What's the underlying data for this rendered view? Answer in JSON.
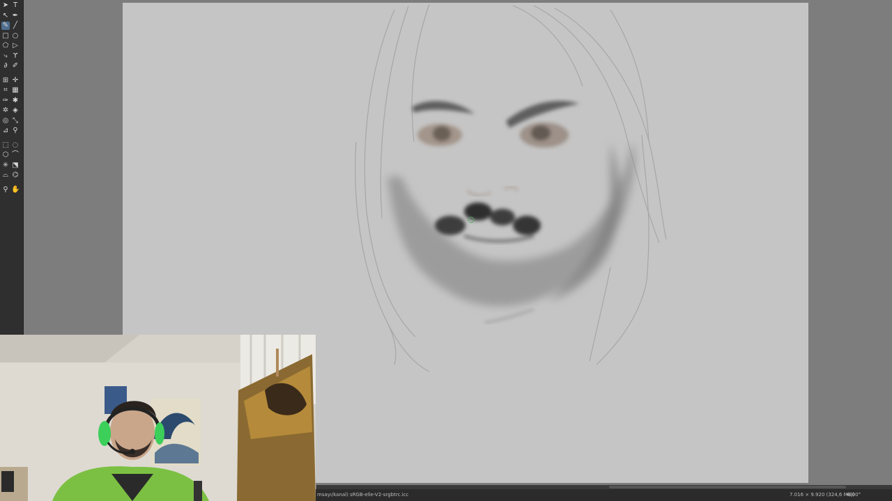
{
  "toolbox": {
    "tools": [
      {
        "name": "select-shapes-tool",
        "glyph": "➤"
      },
      {
        "name": "text-tool",
        "glyph": "T"
      },
      {
        "name": "edit-shapes-tool",
        "glyph": "↖"
      },
      {
        "name": "calligraphy-tool",
        "glyph": "✒"
      },
      {
        "name": "freehand-brush-tool",
        "glyph": "✎",
        "active": true
      },
      {
        "name": "line-tool",
        "glyph": "╱"
      },
      {
        "name": "rectangle-tool",
        "glyph": "□"
      },
      {
        "name": "ellipse-tool",
        "glyph": "○"
      },
      {
        "name": "polygon-tool",
        "glyph": "⬠"
      },
      {
        "name": "polyline-tool",
        "glyph": "▷"
      },
      {
        "name": "bezier-tool",
        "glyph": "⤷"
      },
      {
        "name": "freehand-path-tool",
        "glyph": "ϒ"
      },
      {
        "name": "dynamic-brush-tool",
        "glyph": "∂"
      },
      {
        "name": "multibrush-tool",
        "glyph": "✐"
      },
      {
        "name": "transform-tool",
        "glyph": "⊞"
      },
      {
        "name": "move-tool",
        "glyph": "✛"
      },
      {
        "name": "crop-tool",
        "glyph": "⌗"
      },
      {
        "name": "gradient-tool",
        "glyph": "▦"
      },
      {
        "name": "color-sampler-tool",
        "glyph": "✑"
      },
      {
        "name": "smart-patch-tool",
        "glyph": "✱"
      },
      {
        "name": "pattern-tool",
        "glyph": "✲"
      },
      {
        "name": "fill-tool",
        "glyph": "◈"
      },
      {
        "name": "enclose-fill-tool",
        "glyph": "◎"
      },
      {
        "name": "assistant-tool",
        "glyph": "⤡"
      },
      {
        "name": "measure-tool",
        "glyph": "⊿"
      },
      {
        "name": "reference-tool",
        "glyph": "⚲"
      },
      {
        "name": "rect-select-tool",
        "glyph": "⬚"
      },
      {
        "name": "ellipse-select-tool",
        "glyph": "◌"
      },
      {
        "name": "polygon-select-tool",
        "glyph": "⬡"
      },
      {
        "name": "outline-select-tool",
        "glyph": "⌒"
      },
      {
        "name": "contiguous-select-tool",
        "glyph": "✳"
      },
      {
        "name": "similar-select-tool",
        "glyph": "⬔"
      },
      {
        "name": "bezier-select-tool",
        "glyph": "⌓"
      },
      {
        "name": "magnetic-select-tool",
        "glyph": "⌬"
      },
      {
        "name": "zoom-tool",
        "glyph": "⚲"
      },
      {
        "name": "pan-tool",
        "glyph": "✋"
      }
    ]
  },
  "statusbar": {
    "profile": "msayı/kanal) sRGB-elle-V2-srgbtrc.icc",
    "dimensions": "7.016 × 9.920 (324,6 MiB)",
    "rotation_icon": "↔",
    "rotation": "0,00°"
  },
  "colors": {
    "toolbox_bg": "#2f2f2f",
    "canvas_bg": "#c5c5c5",
    "workspace_bg": "#7d7d7d",
    "active_tool": "#4f6e8f",
    "headset_green": "#3ccf5a",
    "jacket_green": "#7cc043"
  }
}
